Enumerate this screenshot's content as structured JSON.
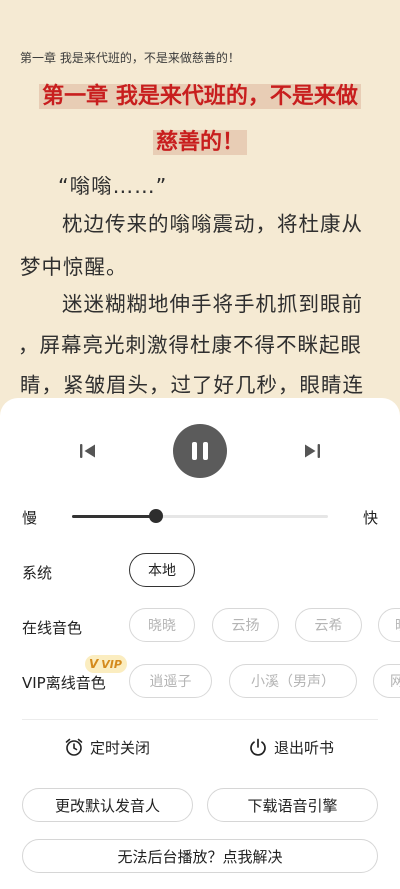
{
  "reader": {
    "running_title": "第一章 我是来代班的，不是来做慈善的！",
    "chapter_heading_line1": "第一章 我是来代班的，不是来做",
    "chapter_heading_line2": "慈善的！",
    "paragraph_lines": [
      "“嗡嗡……”",
      "枕边传来的嗡嗡震动，将杜康从",
      "梦中惊醒。",
      "迷迷糊糊地伸手将手机抓到眼前",
      "，屏幕亮光刺激得杜康不得不眯起眼",
      "睛，紧皱眉头，过了好几秒，眼睛连"
    ]
  },
  "player": {
    "speed_slow": "慢",
    "speed_fast": "快",
    "speed_fraction": 0.33
  },
  "system": {
    "label": "系统",
    "options": [
      "本地"
    ]
  },
  "online_voice": {
    "label": "在线音色",
    "options": [
      "晓晓",
      "云扬",
      "云希",
      "晓"
    ]
  },
  "vip_voice": {
    "label": "VIP离线音色",
    "badge_v": "V",
    "badge_text": "VIP",
    "options": [
      "逍遥子",
      "小溪（男声）",
      "网"
    ]
  },
  "actions": {
    "timer": "定时关闭",
    "exit": "退出听书",
    "change_voice": "更改默认发音人",
    "download_engine": "下载语音引擎",
    "background_help": "无法后台播放？点我解决"
  },
  "colors": {
    "page_bg": "#f5ead3",
    "heading_red": "#c81e1e",
    "heading_highlight": "#e8cdb5",
    "vip_gold": "#d48a1c"
  }
}
